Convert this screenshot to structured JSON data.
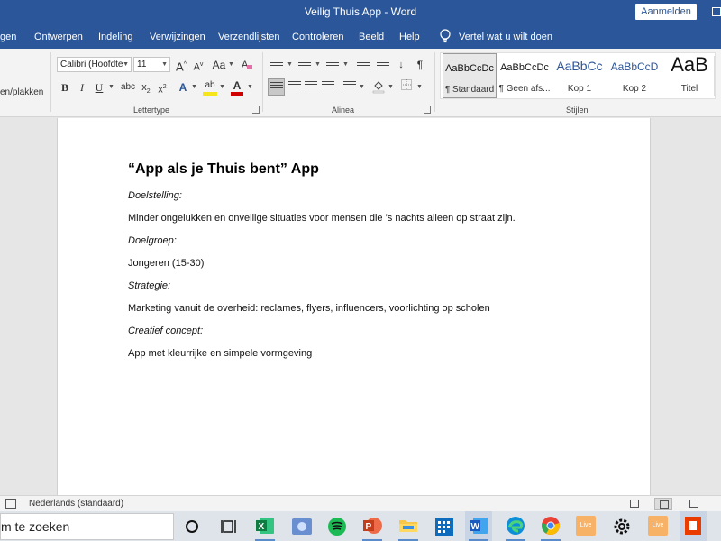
{
  "titlebar": {
    "title": "Veilig Thuis App  -  Word",
    "signin_label": "Aanmelden"
  },
  "tabs": [
    "gen",
    "Ontwerpen",
    "Indeling",
    "Verwijzingen",
    "Verzendlijsten",
    "Controleren",
    "Beeld",
    "Help"
  ],
  "tell_me": "Vertel wat u wilt doen",
  "ribbon": {
    "clipboard_label": "en/plakken",
    "font_name": "Calibri (Hoofdte",
    "font_size": "11",
    "font_group_label": "Lettertype",
    "paragraph_group_label": "Alinea",
    "styles_group_label": "Stijlen",
    "font_buttons": {
      "grow": "A",
      "shrink": "A",
      "case": "Aa",
      "bold": "B",
      "italic": "I",
      "underline": "U",
      "strike": "abc",
      "subscript": "x",
      "superscript": "x",
      "effects": "A",
      "highlight": "ab",
      "color": "A"
    },
    "pilcrow": "¶",
    "sort": "↓",
    "styles": [
      {
        "sample": "AaBbCcDc",
        "name": "¶ Standaard"
      },
      {
        "sample": "AaBbCcDc",
        "name": "¶ Geen afs..."
      },
      {
        "sample": "AaBbCc",
        "name": "Kop 1"
      },
      {
        "sample": "AaBbCcD",
        "name": "Kop 2"
      },
      {
        "sample": "AaB",
        "name": "Titel"
      }
    ],
    "colors": {
      "highlight": "#f5e51a",
      "font_color": "#d00000",
      "heading_blue": "#2f5597"
    }
  },
  "document": {
    "title": "“App als je Thuis bent” App",
    "lines": [
      {
        "text": "Doelstelling:",
        "italic": true
      },
      {
        "text": "Minder ongelukken en onveilige situaties voor mensen die ’s nachts alleen op straat zijn.",
        "italic": false
      },
      {
        "text": "Doelgroep:",
        "italic": true
      },
      {
        "text": "Jongeren (15-30)",
        "italic": false
      },
      {
        "text": "Strategie:",
        "italic": true
      },
      {
        "text": "Marketing vanuit de overheid: reclames, flyers, influencers, voorlichting op scholen",
        "italic": false
      },
      {
        "text": "Creatief concept:",
        "italic": true
      },
      {
        "text": "App met kleurrijke en simpele vormgeving",
        "italic": false
      }
    ]
  },
  "statusbar": {
    "language": "Nederlands (standaard)"
  },
  "taskbar": {
    "search_text": "m te zoeken",
    "apps": [
      "cortana-icon",
      "task-view-icon",
      "excel-icon",
      "app-icon",
      "spotify-icon",
      "powerpoint-icon",
      "file-explorer-icon",
      "calendar-icon",
      "word-icon",
      "edge-icon",
      "chrome-icon",
      "live-icon",
      "settings-icon",
      "live-icon",
      "office-icon"
    ],
    "live_label": "Live"
  },
  "accent": "#2b579a"
}
